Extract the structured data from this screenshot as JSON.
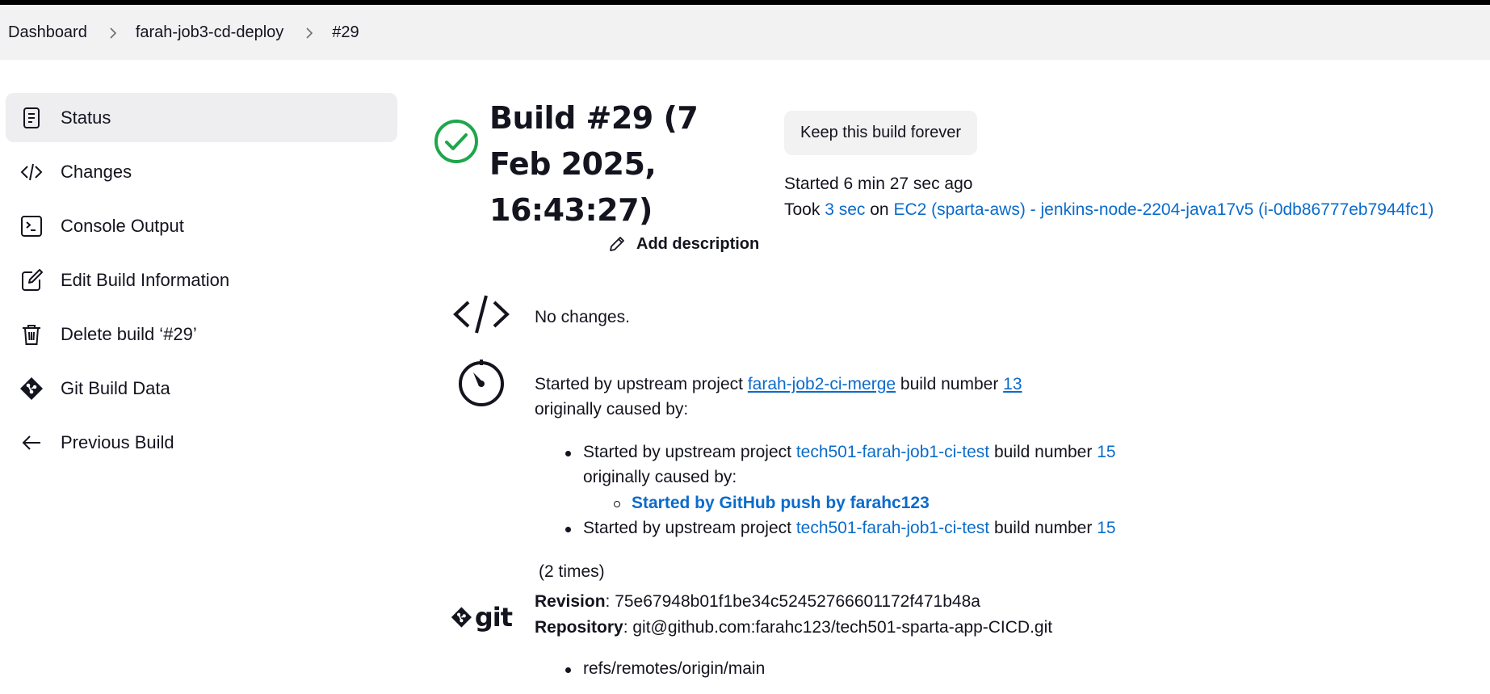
{
  "breadcrumb": {
    "items": [
      "Dashboard",
      "farah-job3-cd-deploy",
      "#29"
    ]
  },
  "sidebar": {
    "items": [
      {
        "label": "Status",
        "icon": "document-icon"
      },
      {
        "label": "Changes",
        "icon": "code-icon"
      },
      {
        "label": "Console Output",
        "icon": "terminal-icon"
      },
      {
        "label": "Edit Build Information",
        "icon": "edit-icon"
      },
      {
        "label": "Delete build ‘#29’",
        "icon": "trash-icon"
      },
      {
        "label": "Git Build Data",
        "icon": "git-icon"
      },
      {
        "label": "Previous Build",
        "icon": "arrow-left-icon"
      }
    ]
  },
  "build": {
    "title": "Build #29 (7 Feb 2025, 16:43:27)",
    "keep_label": "Keep this build forever",
    "started": "Started 6 min 27 sec ago",
    "took_prefix": "Took",
    "took_duration": "3 sec",
    "took_on": "on",
    "agent": "EC2 (sparta-aws) - jenkins-node-2204-java17v5 (i-0db86777eb7944fc1)",
    "add_description": "Add description"
  },
  "changes": {
    "text": "No changes."
  },
  "cause": {
    "prefix": "Started by upstream project",
    "project": "farah-job2-ci-merge",
    "build_number_label": "build number",
    "build_number": "13",
    "caused_by": "originally caused by:",
    "sub": [
      {
        "prefix": "Started by upstream project",
        "project": "tech501-farah-job1-ci-test",
        "build_number_label": "build number",
        "build_number": "15",
        "caused_by": "originally caused by:",
        "nested": "Started by GitHub push by farahc123"
      },
      {
        "prefix": "Started by upstream project",
        "project": "tech501-farah-job1-ci-test",
        "build_number_label": "build number",
        "build_number": "15"
      }
    ],
    "times": "(2 times)"
  },
  "git": {
    "logo_text": "git",
    "revision_label": "Revision",
    "revision": ": 75e67948b01f1be34c52452766601172f471b48a",
    "repository_label": "Repository",
    "repository": ": git@github.com:farahc123/tech501-sparta-app-CICD.git",
    "branch": "refs/remotes/origin/main"
  },
  "colors": {
    "success": "#1ea64b",
    "link": "#0b6bcb",
    "active_bg": "#eeeef1"
  }
}
